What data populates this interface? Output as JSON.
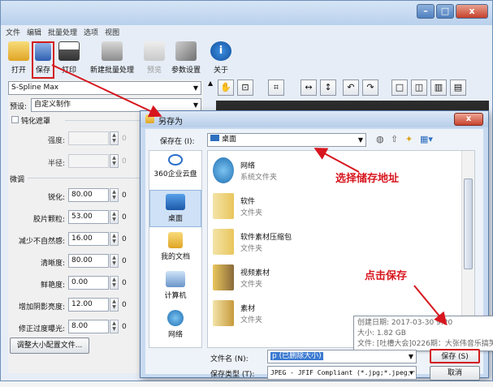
{
  "menu": [
    "文件",
    "编辑",
    "批量处理",
    "选项",
    "视图"
  ],
  "toolbar": {
    "open": "打开",
    "save": "保存",
    "print": "打印",
    "new_batch": "新建批量处理",
    "preview": "预览",
    "settings": "参数设置",
    "about": "关于"
  },
  "left": {
    "algorithm": "S-Spline Max",
    "preset_label": "预设:",
    "preset_value": "自定义制作",
    "sharpen_mask_label": "钝化遮罩",
    "strength_label": "强度:",
    "radius_label": "半径:",
    "tune_group": "微调",
    "zero": "0",
    "fields": [
      {
        "label": "锐化:",
        "value": "80.00"
      },
      {
        "label": "胶片颗粒:",
        "value": "53.00"
      },
      {
        "label": "减少不自然感:",
        "value": "16.00"
      },
      {
        "label": "清晰度:",
        "value": "80.00"
      },
      {
        "label": "鲜艳度:",
        "value": "0.00"
      },
      {
        "label": "增加阴影亮度:",
        "value": "12.00"
      },
      {
        "label": "修正过度曝光:",
        "value": "8.00"
      }
    ],
    "resize_button": "调整大小配置文件..."
  },
  "dialog": {
    "title": "另存为",
    "save_in_label": "保存在 (I):",
    "save_in_value": "桌面",
    "places": [
      {
        "label": "360企业云盘"
      },
      {
        "label": "桌面"
      },
      {
        "label": "我的文档"
      },
      {
        "label": "计算机"
      },
      {
        "label": "网络"
      }
    ],
    "files": [
      {
        "name": "网络",
        "type": "系统文件夹"
      },
      {
        "name": "软件",
        "type": "文件夹"
      },
      {
        "name": "软件素材压缩包",
        "type": "文件夹"
      },
      {
        "name": "视频素材",
        "type": "文件夹"
      },
      {
        "name": "素材",
        "type": "文件夹"
      }
    ],
    "tooltip": {
      "created": "创建日期: 2017-03-30 9:20",
      "size": "大小: 1.82 GB",
      "files": "文件: [吐槽大会]0226期：大张伟音乐搞笑"
    },
    "filename_label": "文件名 (N):",
    "filename_value": "p (已删除大小)",
    "filetype_label": "保存类型 (T):",
    "filetype_value": "JPEG - JFIF Compliant (*.jpg;*.jpeg;*",
    "save_button": "保存 (S)",
    "cancel_button": "取消"
  },
  "annotations": {
    "choose_location": "选择储存地址",
    "click_save": "点击保存"
  },
  "colors": {
    "annotation": "#d7161e",
    "window_frame": "#6f8fb7",
    "dialog_bg": "#c8daf0"
  }
}
